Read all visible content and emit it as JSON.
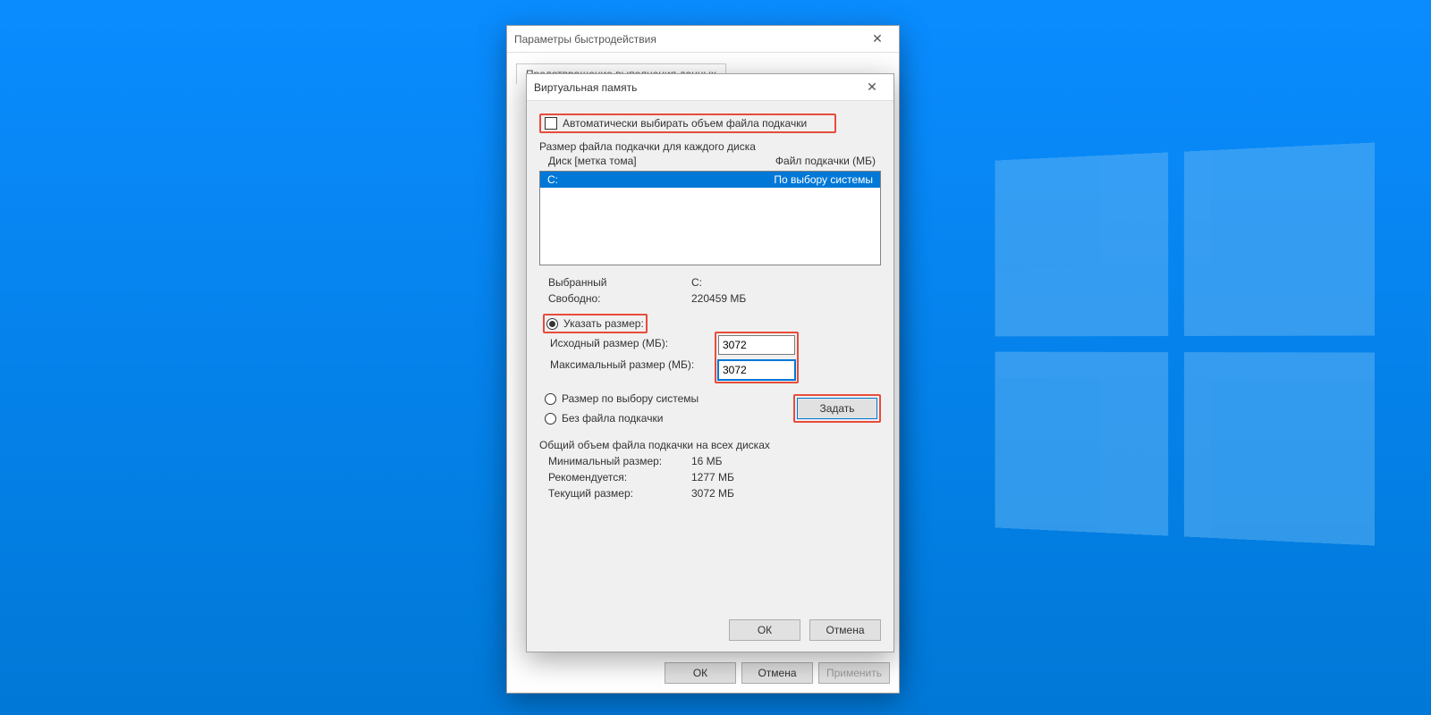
{
  "desktop": {
    "logo": "windows"
  },
  "parent": {
    "title": "Параметры быстродействия",
    "tab_dep": "Предотвращение выполнения данных",
    "footer": {
      "ok": "ОК",
      "cancel": "Отмена",
      "apply": "Применить"
    }
  },
  "vm": {
    "title": "Виртуальная память",
    "auto_label": "Автоматически выбирать объем файла подкачки",
    "size_each": "Размер файла подкачки для каждого диска",
    "col_drive": "Диск [метка тома]",
    "col_file": "Файл подкачки (МБ)",
    "drive_row": {
      "name": "C:",
      "value": "По выбору системы"
    },
    "selected_lbl": "Выбранный",
    "selected_val": "C:",
    "free_lbl": "Свободно:",
    "free_val": "220459 МБ",
    "radio_custom": "Указать размер:",
    "initial_lbl": "Исходный размер (МБ):",
    "initial_val": "3072",
    "max_lbl": "Максимальный размер (МБ):",
    "max_val": "3072",
    "radio_system": "Размер по выбору системы",
    "radio_none": "Без файла подкачки",
    "set_btn": "Задать",
    "totals_title": "Общий объем файла подкачки на всех дисках",
    "min_lbl": "Минимальный размер:",
    "min_val": "16 МБ",
    "rec_lbl": "Рекомендуется:",
    "rec_val": "1277 МБ",
    "cur_lbl": "Текущий размер:",
    "cur_val": "3072 МБ",
    "ok": "ОК",
    "cancel": "Отмена"
  }
}
